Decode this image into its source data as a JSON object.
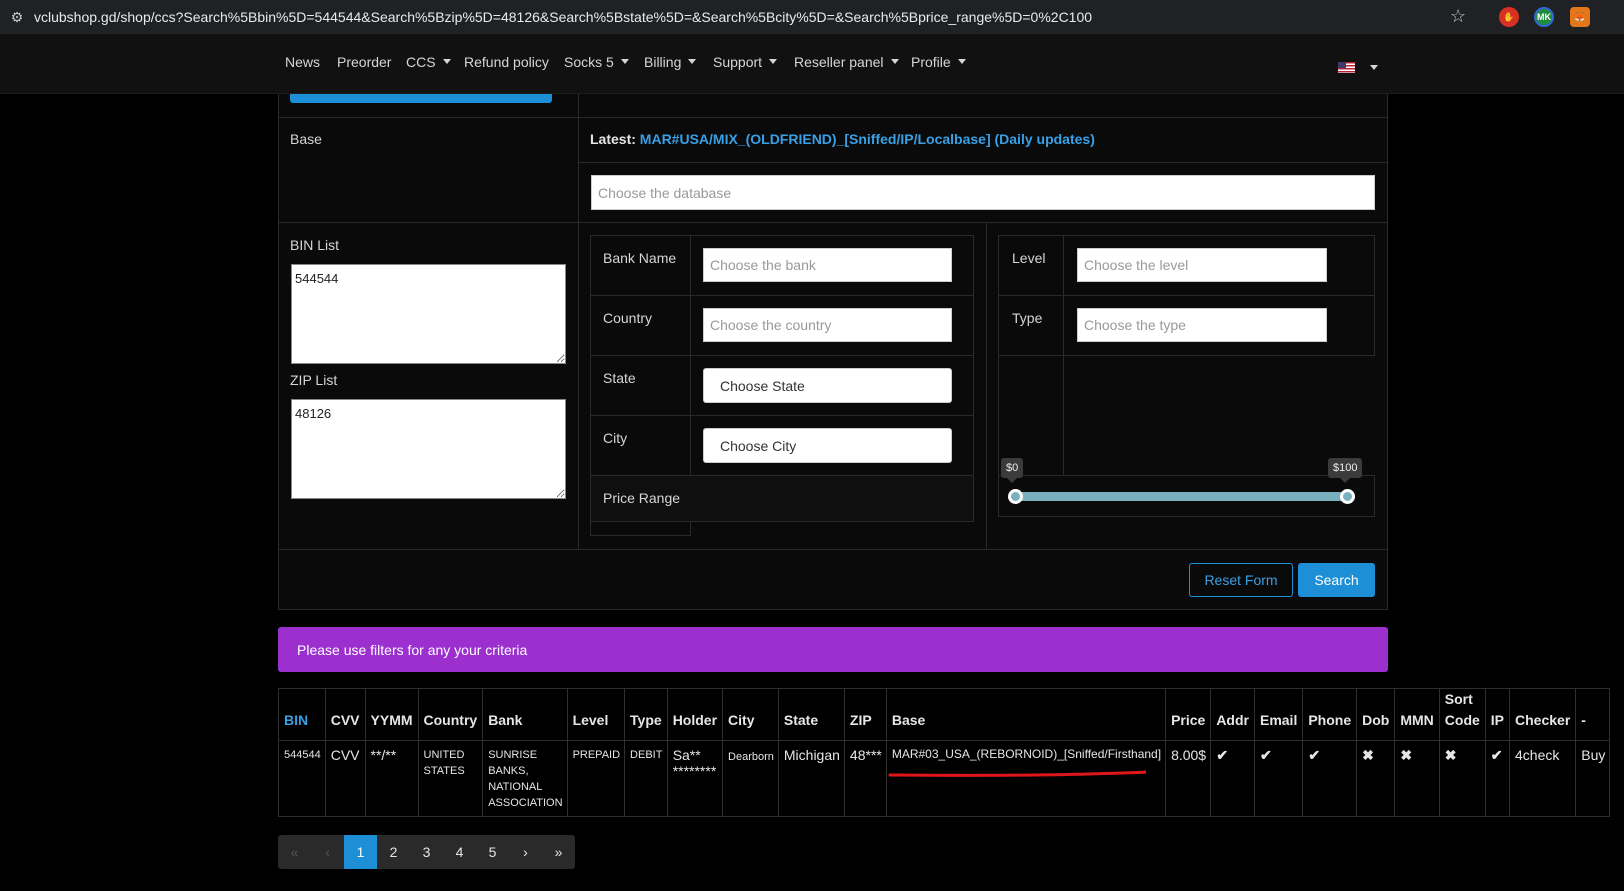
{
  "browser": {
    "url": "vclubshop.gd/shop/ccs?Search%5Bbin%5D=544544&Search%5Bzip%5D=48126&Search%5Bstate%5D=&Search%5Bcity%5D=&Search%5Bprice_range%5D=0%2C100",
    "extension_badge": "MK"
  },
  "nav": {
    "items": [
      "News",
      "Preorder",
      "CCS",
      "Refund policy",
      "Socks 5",
      "Billing",
      "Support",
      "Reseller panel",
      "Profile"
    ]
  },
  "form": {
    "base_label": "Base",
    "latest_prefix": "Latest:",
    "latest_link": "MAR#USA/MIX_(OLDFRIEND)_[Sniffed/IP/Localbase] (Daily updates)",
    "database_placeholder": "Choose the database",
    "bin_list_label": "BIN List",
    "bin_list_value": "544544",
    "zip_list_label": "ZIP List",
    "zip_list_value": "48126",
    "bank_label": "Bank Name",
    "bank_placeholder": "Choose the bank",
    "country_label": "Country",
    "country_placeholder": "Choose the country",
    "state_label": "State",
    "state_value": "Choose State",
    "city_label": "City",
    "city_value": "Choose City",
    "price_label": "Price Range",
    "level_label": "Level",
    "level_placeholder": "Choose the level",
    "type_label": "Type",
    "type_placeholder": "Choose the type",
    "price_min": "$0",
    "price_max": "$100",
    "reset_label": "Reset Form",
    "search_label": "Search"
  },
  "alert": "Please use filters for any your criteria",
  "table": {
    "headers": [
      "BIN",
      "CVV",
      "YYMM",
      "Country",
      "Bank",
      "Level",
      "Type",
      "Holder",
      "City",
      "State",
      "ZIP",
      "Base",
      "Price",
      "Addr",
      "Email",
      "Phone",
      "Dob",
      "MMN",
      "Sort Code",
      "IP",
      "Checker",
      "-"
    ],
    "row": {
      "bin": "544544",
      "cvv": "CVV",
      "yymm": "**/**",
      "country": "UNITED STATES",
      "bank": "SUNRISE BANKS, NATIONAL ASSOCIATION",
      "level": "PREPAID",
      "type": "DEBIT",
      "holder": "Sa** ********",
      "city": "Dearborn",
      "state": "Michigan",
      "zip": "48***",
      "base": "MAR#03_USA_(REBORNOID)_[Sniffed/Firsthand]",
      "price": "8.00$",
      "addr": "✔",
      "email": "✔",
      "phone": "✔",
      "dob": "✖",
      "mmn": "✖",
      "sort_code": "✖",
      "ip": "✔",
      "checker": "4check",
      "buy": "Buy"
    }
  },
  "pager": {
    "first": "«",
    "prev": "‹",
    "pages": [
      "1",
      "2",
      "3",
      "4",
      "5"
    ],
    "next": "›",
    "last": "»"
  },
  "colors": {
    "accent": "#1d8fd6",
    "alert": "#9b30cf",
    "ok": "#2ecc40",
    "no": "#ff3b3b"
  }
}
